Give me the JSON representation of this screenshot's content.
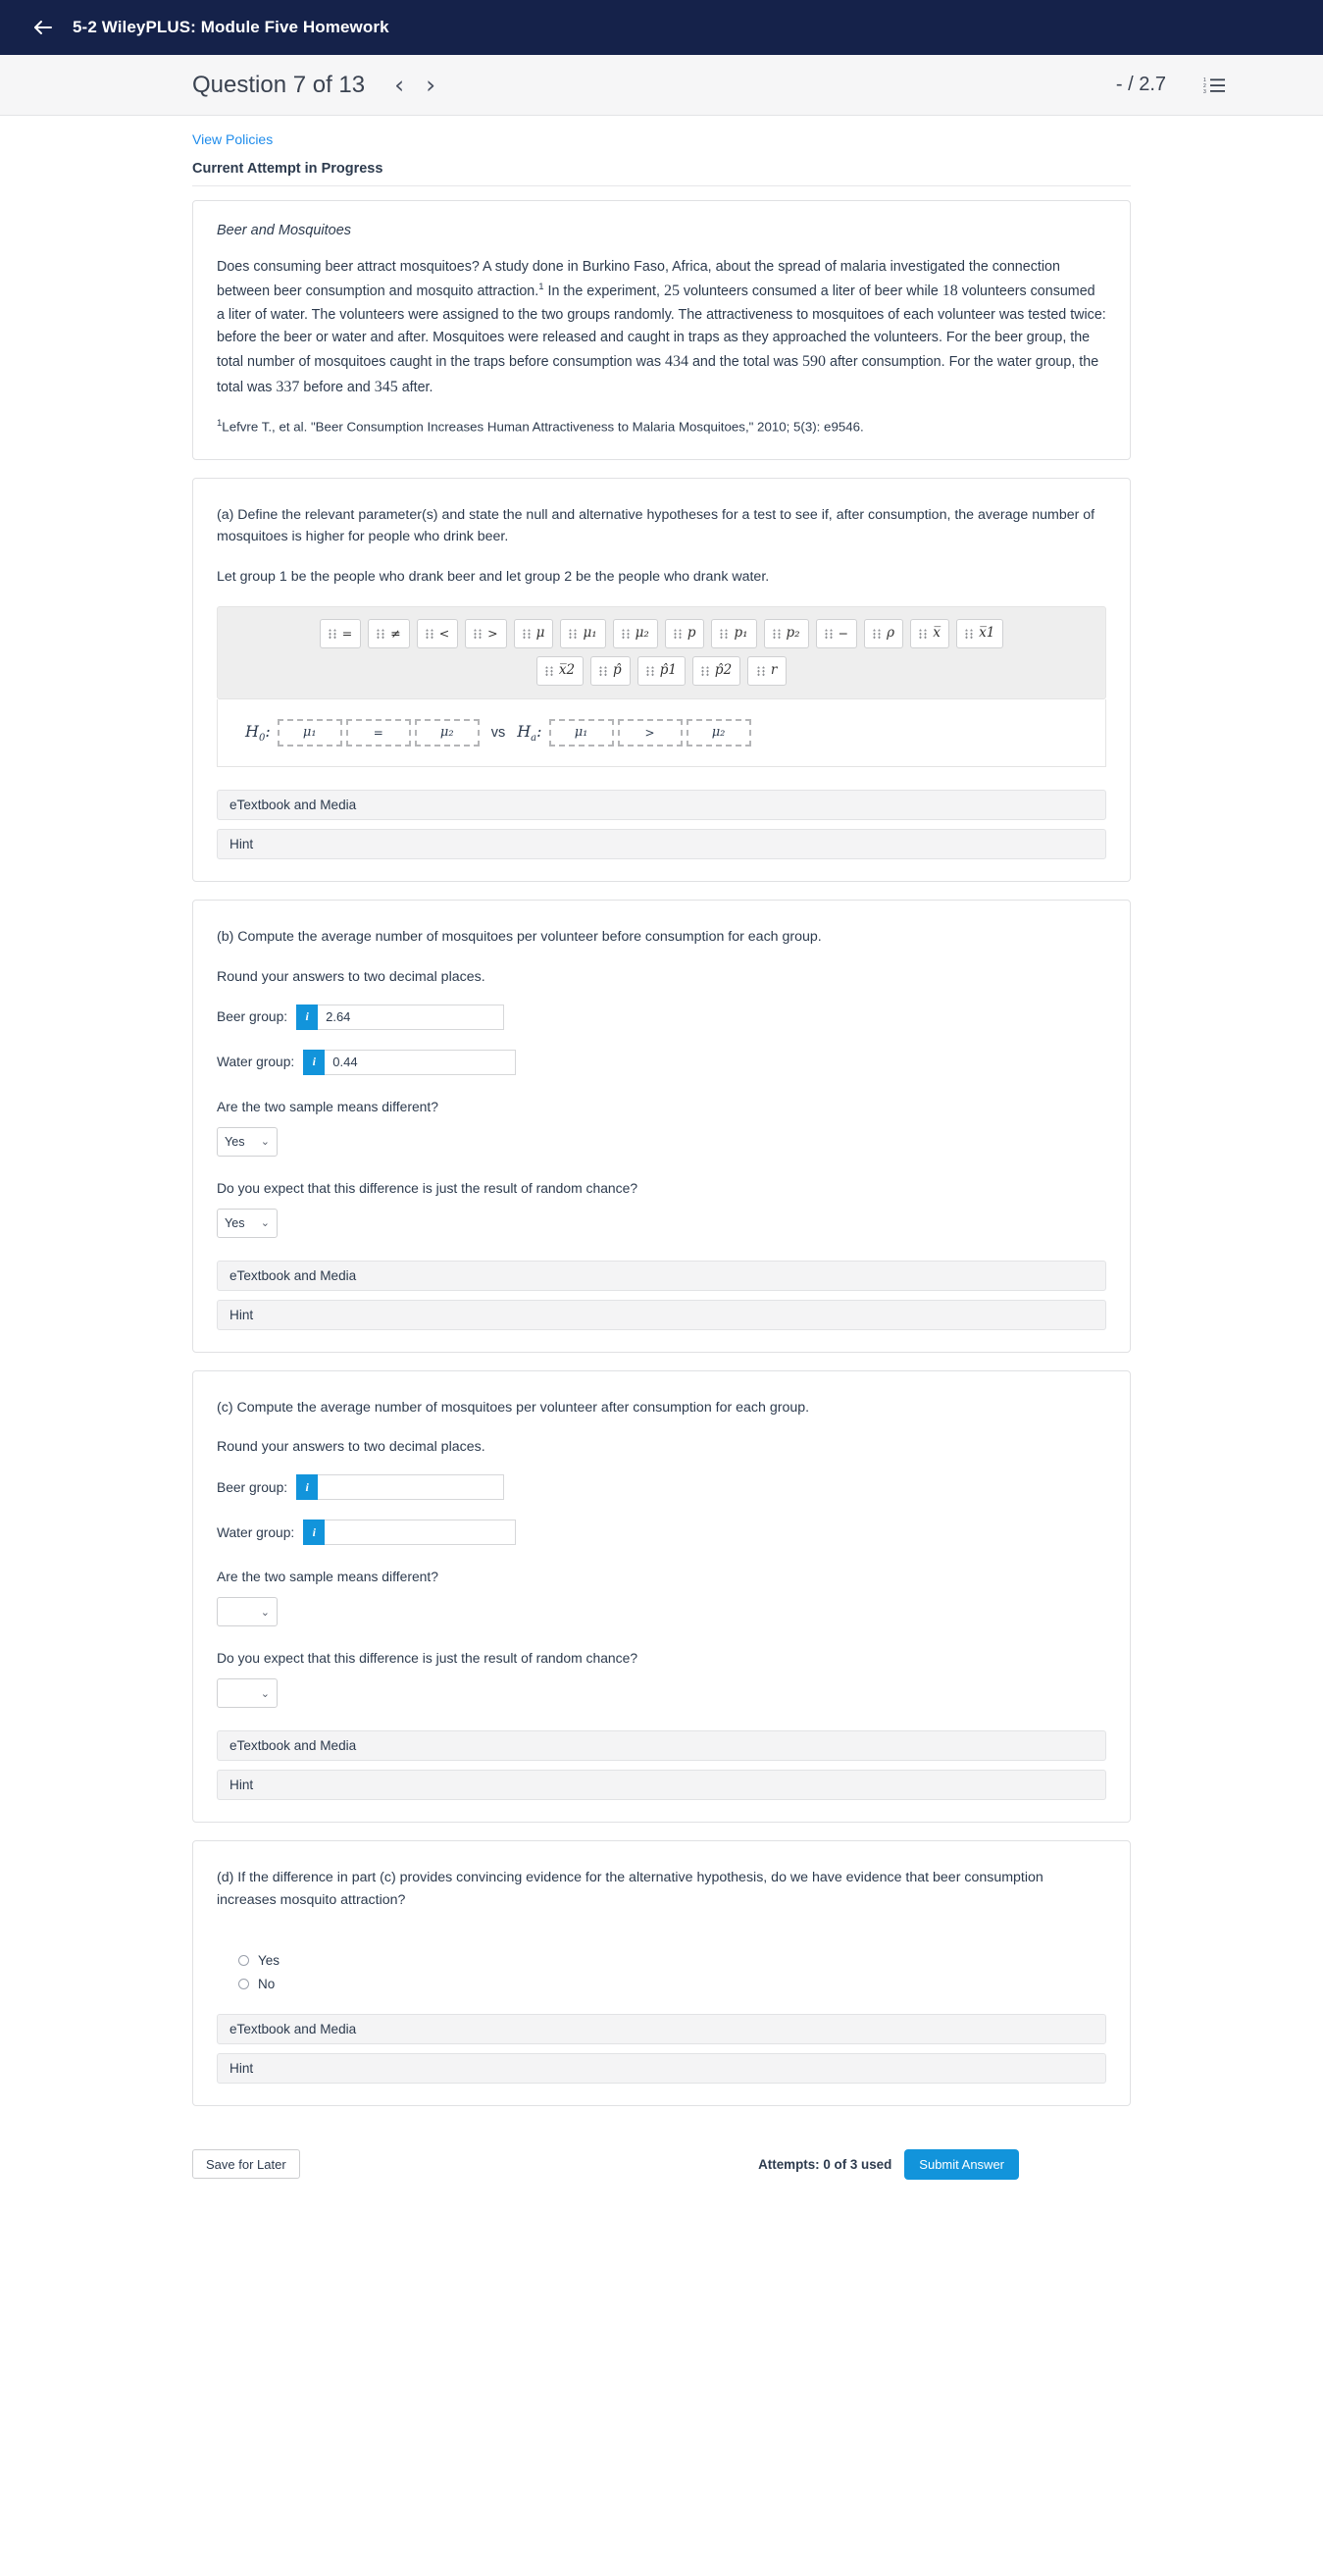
{
  "appbar": {
    "title": "5-2 WileyPLUS: Module Five Homework",
    "back_icon": "arrow-left-icon"
  },
  "question_header": {
    "title": "Question 7 of 13",
    "prev_icon": "‹",
    "next_icon": "›",
    "score": "- / 2.7",
    "list_icon": "numbered-list-icon"
  },
  "links": {
    "view_policies": "View Policies"
  },
  "attempt_status": "Current Attempt in Progress",
  "problem": {
    "title": "Beer and Mosquitoes",
    "text_1": "Does consuming beer attract mosquitoes? A study done in Burkino Faso, Africa, about the spread of malaria investigated the connection between beer consumption and mosquito attraction.",
    "ref_marker": "1",
    "text_2": " In the experiment, ",
    "n_beer": "25",
    "text_3": " volunteers consumed a liter of beer while ",
    "n_water": "18",
    "text_4": " volunteers consumed a liter of water. The volunteers were assigned to the two groups randomly. The attractiveness to mosquitoes of each volunteer was tested twice: before the beer or water and after. Mosquitoes were released and caught in traps as they approached the volunteers. For the beer group, the total number of mosquitoes caught in the traps before consumption was ",
    "beer_before": "434",
    "text_5": " and the total was ",
    "beer_after": "590",
    "text_6": " after consumption. For the water group, the total was ",
    "water_before": "337",
    "text_7": " before and ",
    "water_after": "345",
    "text_8": " after.",
    "footnote_marker": "1",
    "footnote": "Lefvre T., et al. \"Beer Consumption Increases Human Attractiveness to Malaria Mosquitoes,\" 2010; 5(3): e9546."
  },
  "part_a": {
    "prompt": "(a) Define the relevant parameter(s) and state the null and alternative hypotheses for a test to see if, after consumption, the average number of mosquitoes is higher for people who drink beer.",
    "group_note_1": "Let group ",
    "group_1": "1",
    "group_note_2": " be the people who drank beer and let group ",
    "group_2": "2",
    "group_note_3": " be the people who drank water.",
    "palette_row_1": [
      {
        "name": "equals-key",
        "sym": "=",
        "style": "op"
      },
      {
        "name": "not-equals-key",
        "sym": "≠",
        "style": "op"
      },
      {
        "name": "less-than-key",
        "sym": "<",
        "style": "op"
      },
      {
        "name": "greater-than-key",
        "sym": ">",
        "style": "op"
      },
      {
        "name": "mu-key",
        "sym": "μ",
        "style": "var"
      },
      {
        "name": "mu1-key",
        "sym": "μ₁",
        "style": "var"
      },
      {
        "name": "mu2-key",
        "sym": "μ₂",
        "style": "var"
      },
      {
        "name": "p-key",
        "sym": "p",
        "style": "var"
      },
      {
        "name": "p1-key",
        "sym": "p₁",
        "style": "var"
      },
      {
        "name": "p2-key",
        "sym": "p₂",
        "style": "var"
      },
      {
        "name": "minus-key",
        "sym": "−",
        "style": "op"
      },
      {
        "name": "rho-key",
        "sym": "ρ",
        "style": "var"
      },
      {
        "name": "xbar-key",
        "sym": "x̅",
        "style": "var"
      },
      {
        "name": "xbar1-key",
        "sym": "x̅1",
        "style": "var"
      }
    ],
    "palette_row_2": [
      {
        "name": "xbar2-key",
        "sym": "x̅2",
        "style": "var"
      },
      {
        "name": "phat-key",
        "sym": "p̂",
        "style": "var"
      },
      {
        "name": "phat1-key",
        "sym": "p̂1",
        "style": "var"
      },
      {
        "name": "phat2-key",
        "sym": "p̂2",
        "style": "var"
      },
      {
        "name": "r-key",
        "sym": "r",
        "style": "var"
      }
    ],
    "hypothesis": {
      "null_label": "H",
      "null_sub": "0",
      "null_left": "μ₁",
      "null_op": "=",
      "null_right": "μ₂",
      "vs": "vs",
      "alt_label": "H",
      "alt_sub": "a",
      "alt_left": "μ₁",
      "alt_op": ">",
      "alt_right": "μ₂"
    },
    "etextbook": "eTextbook and Media",
    "hint": "Hint"
  },
  "part_b": {
    "prompt": "(b) Compute the average number of mosquitoes per volunteer before consumption for each group.",
    "rounding": "Round your answers to two decimal places.",
    "beer_label": "Beer group:",
    "beer_value": "2.64",
    "water_label": "Water group:",
    "water_value": "0.44",
    "info_glyph": "i",
    "q1": "Are the two sample means different?",
    "q1_value": "Yes",
    "q2": "Do you expect that this difference is just the result of random chance?",
    "q2_value": "Yes",
    "chevron": "⌄",
    "etextbook": "eTextbook and Media",
    "hint": "Hint"
  },
  "part_c": {
    "prompt": "(c) Compute the average number of mosquitoes per volunteer after consumption for each group.",
    "rounding": "Round your answers to two decimal places.",
    "beer_label": "Beer group:",
    "beer_value": "",
    "water_label": "Water group:",
    "water_value": "",
    "info_glyph": "i",
    "q1": "Are the two sample means different?",
    "q1_value": "",
    "q2": "Do you expect that this difference is just the result of random chance?",
    "q2_value": "",
    "chevron": "⌄",
    "etextbook": "eTextbook and Media",
    "hint": "Hint"
  },
  "part_d": {
    "prompt": "(d) If the difference in part (c) provides convincing evidence for the alternative hypothesis, do we have evidence that beer consumption increases mosquito attraction?",
    "option_yes": "Yes",
    "option_no": "No",
    "etextbook": "eTextbook and Media",
    "hint": "Hint"
  },
  "footer": {
    "save_label": "Save for Later",
    "attempts": "Attempts: 0 of 3 used",
    "submit_label": "Submit Answer"
  },
  "colors": {
    "appbar_bg": "#15224a",
    "accent_blue": "#1294db",
    "link_blue": "#1f8ceb"
  }
}
